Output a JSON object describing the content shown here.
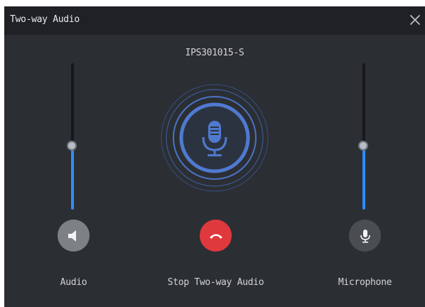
{
  "window": {
    "title": "Two-way Audio",
    "close_icon": "close-icon"
  },
  "device": {
    "name": "IPS301015-S"
  },
  "audio": {
    "label": "Audio",
    "volume_fraction": 0.43,
    "icon": "speaker-icon"
  },
  "talk": {
    "label": "Stop Two-way Audio",
    "status_icon": "microphone-icon",
    "stop_icon": "hang-up-icon"
  },
  "microphone": {
    "label": "Microphone",
    "volume_fraction": 0.43,
    "icon": "microphone-icon"
  },
  "colors": {
    "background": "#2b2e33",
    "titlebar": "#1f2125",
    "accent": "#2f8cff",
    "ring": "#4a73c6",
    "stop": "#e0393d",
    "speaker_button": "#7d8085",
    "mic_button": "#4a4d52"
  }
}
